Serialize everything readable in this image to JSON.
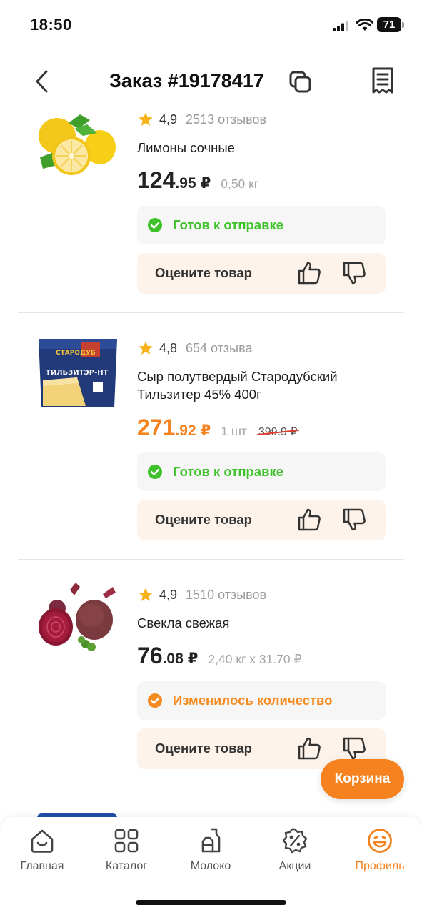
{
  "status_bar": {
    "time": "18:50",
    "battery": "71"
  },
  "header": {
    "title": "Заказ #19178417"
  },
  "items": [
    {
      "rating": "4,9",
      "reviews": "2513 отзывов",
      "name": "Лимоны сочные",
      "price_main": "124",
      "price_cents": ".95",
      "currency": "₽",
      "qty": "0,50 кг",
      "old_price": "",
      "status": "Готов к отправке",
      "status_kind": "green",
      "rate_label": "Оцените товар"
    },
    {
      "rating": "4,8",
      "reviews": "654 отзыва",
      "name": "Сыр полутвердый Стародубский Тильзитер 45% 400г",
      "price_main": "271",
      "price_cents": ".92",
      "currency": "₽",
      "qty": "1 шт",
      "old_price": "399.9 ₽",
      "status": "Готов к отправке",
      "status_kind": "green",
      "rate_label": "Оцените товар"
    },
    {
      "rating": "4,9",
      "reviews": "1510 отзывов",
      "name": "Свекла свежая",
      "price_main": "76",
      "price_cents": ".08",
      "currency": "₽",
      "qty": "2,40 кг x 31.70 ₽",
      "old_price": "",
      "status": "Изменилось количество",
      "status_kind": "orange",
      "rate_label": "Оцените товар"
    }
  ],
  "cart_button": "Корзина",
  "tabs": [
    {
      "label": "Главная",
      "icon": "home-icon"
    },
    {
      "label": "Каталог",
      "icon": "catalog-grid-icon"
    },
    {
      "label": "Молоко",
      "icon": "milk-icon"
    },
    {
      "label": "Акции",
      "icon": "promo-percent-icon"
    },
    {
      "label": "Профиль",
      "icon": "profile-smile-icon",
      "active": true
    }
  ],
  "colors": {
    "accent": "#f5821f",
    "ready_green": "#3ec12b",
    "rate_bg": "#fdf3ea"
  }
}
